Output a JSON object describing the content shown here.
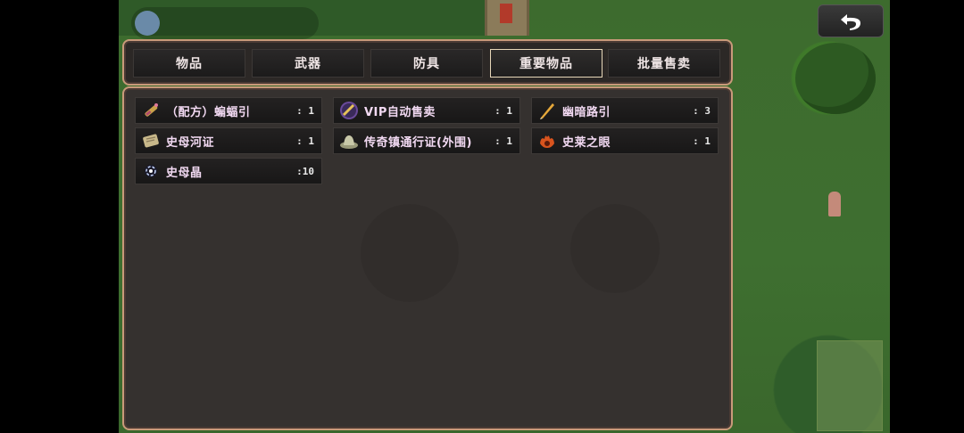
{
  "tabs": [
    {
      "label": "物品"
    },
    {
      "label": "武器"
    },
    {
      "label": "防具"
    },
    {
      "label": "重要物品"
    },
    {
      "label": "批量售卖"
    }
  ],
  "active_tab": "重要物品",
  "items": [
    {
      "name": "（配方）蝙蝠引",
      "count": ": 1",
      "icon": "recipe-scroll-icon"
    },
    {
      "name": "VIP自动售卖",
      "count": ": 1",
      "icon": "vip-coin-icon"
    },
    {
      "name": "幽暗路引",
      "count": ": 3",
      "icon": "golden-quill-icon"
    },
    {
      "name": "史母河证",
      "count": ": 1",
      "icon": "river-pass-scroll-icon"
    },
    {
      "name": "传奇镇通行证(外围)",
      "count": ": 1",
      "icon": "hat-pass-icon"
    },
    {
      "name": "史莱之眼",
      "count": ": 1",
      "icon": "flame-eye-icon"
    },
    {
      "name": "史母晶",
      "count": ":10",
      "icon": "crystal-orb-icon"
    }
  ],
  "colors": {
    "frame_border": "#c99a7a",
    "item_text": "#f2d9f2",
    "panel_bg": "#35312f"
  },
  "back_button": {
    "icon": "back-arrow-icon"
  }
}
